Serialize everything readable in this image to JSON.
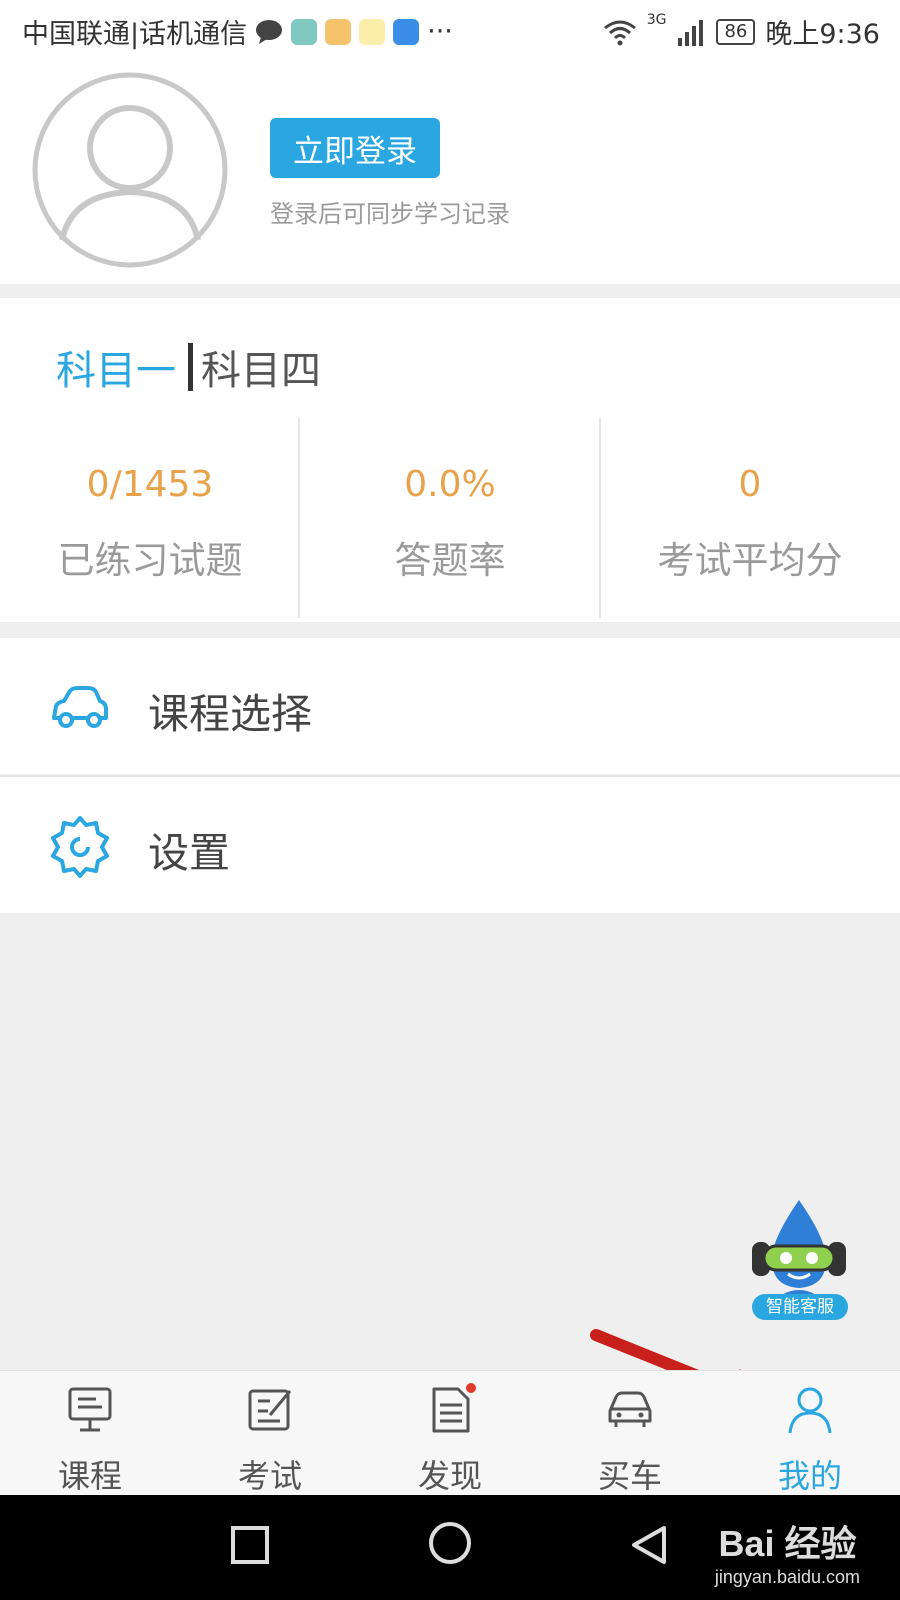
{
  "status_bar": {
    "carrier": "中国联通|话机通信",
    "more": "···",
    "network": "3G",
    "battery": "86",
    "time": "晚上9:36"
  },
  "profile": {
    "login_button": "立即登录",
    "login_hint": "登录后可同步学习记录"
  },
  "subjects": {
    "active": "科目一",
    "other": "科目四"
  },
  "stats": [
    {
      "value": "0/1453",
      "label": "已练习试题"
    },
    {
      "value": "0.0%",
      "label": "答题率"
    },
    {
      "value": "0",
      "label": "考试平均分"
    }
  ],
  "menu": [
    {
      "label": "课程选择",
      "icon": "car-icon"
    },
    {
      "label": "设置",
      "icon": "gear-icon"
    }
  ],
  "assistant": {
    "label": "智能客服"
  },
  "tabs": [
    {
      "label": "课程",
      "icon": "monitor-icon"
    },
    {
      "label": "考试",
      "icon": "exam-icon"
    },
    {
      "label": "发现",
      "icon": "document-icon"
    },
    {
      "label": "买车",
      "icon": "car-icon"
    },
    {
      "label": "我的",
      "icon": "user-icon",
      "active": true
    }
  ],
  "watermark": {
    "brand": "Bai 经验",
    "url": "jingyan.baidu.com"
  },
  "colors": {
    "accent": "#2aa6e0",
    "stat": "#e8a24a",
    "arrow": "#c8201a"
  }
}
